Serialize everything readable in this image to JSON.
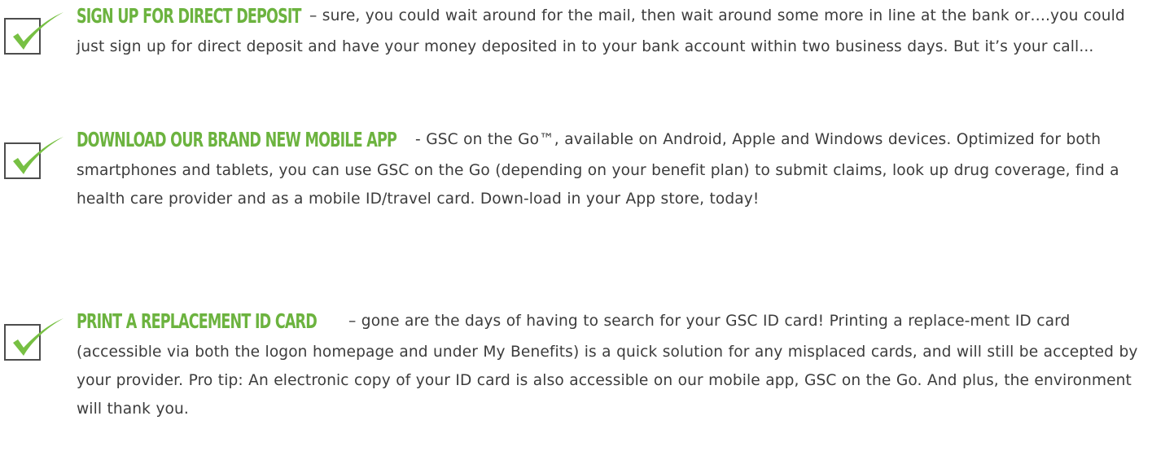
{
  "colors": {
    "heading_green": "#6cb33f",
    "check_green": "#77c043",
    "box_gray": "#4d4d4d",
    "body_text": "#3c3c3c"
  },
  "items": [
    {
      "icon": "checkbox-checked-icon",
      "heading": "SIGN UP FOR DIRECT DEPOSIT",
      "body": "– sure, you could wait around for the mail, then wait around some more in line at the bank or….you could just sign up for direct deposit and have your money deposited in to your bank account within two business days. But it’s your call..."
    },
    {
      "icon": "checkbox-checked-icon",
      "heading": "DOWNLOAD OUR BRAND NEW MOBILE APP",
      "body": "- GSC on the Go™, available on Android, Apple and Windows devices. Optimized for both smartphones and tablets, you can use GSC on the Go (depending on your benefit plan) to submit claims, look up drug coverage, find a health care provider and as a mobile ID/travel card. Down-load in your App store, today!"
    },
    {
      "icon": "checkbox-checked-icon",
      "heading": "PRINT A REPLACEMENT ID CARD",
      "body": "– gone are the days of having to search for your GSC ID card! Printing a replace-ment ID card (accessible via both the logon homepage and under My Benefits) is a quick solution for any misplaced cards, and will still be accepted by your provider. Pro tip: An electronic copy of your ID card is also accessible on our mobile app, GSC on the Go. And plus, the environment will thank you."
    }
  ]
}
